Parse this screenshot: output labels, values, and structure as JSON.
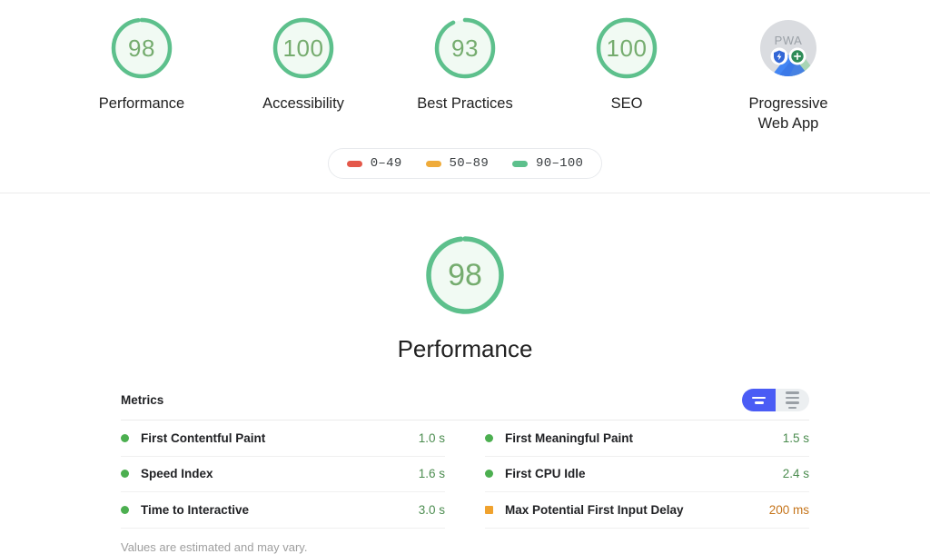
{
  "colors": {
    "pass": "#5dc08c",
    "pass_text": "#75ac6e",
    "pass_fill": "#f1faf3",
    "average": "#efab3a",
    "fail": "#e4584a",
    "metric_pass": "#4caf50",
    "metric_pass_text": "#4b8c4f",
    "metric_average": "#f0a22e",
    "metric_average_text": "#c5741a",
    "toggle_active": "#4a5cf5",
    "toggle_inactive": "#eceff1"
  },
  "summary": {
    "gauges": [
      {
        "label": "Performance",
        "score": "98",
        "value": 98,
        "status": "pass"
      },
      {
        "label": "Accessibility",
        "score": "100",
        "value": 100,
        "status": "pass"
      },
      {
        "label": "Best Practices",
        "score": "93",
        "value": 93,
        "status": "pass"
      },
      {
        "label": "SEO",
        "score": "100",
        "value": 100,
        "status": "pass"
      }
    ],
    "pwa": {
      "label": "Progressive Web App",
      "label_line1": "Progressive",
      "label_line2": "Web App",
      "badge_text": "PWA"
    },
    "legend": [
      {
        "range": "0–49",
        "color": "#e4584a"
      },
      {
        "range": "50–89",
        "color": "#efab3a"
      },
      {
        "range": "90–100",
        "color": "#5dc08c"
      }
    ]
  },
  "category": {
    "title": "Performance",
    "score": "98",
    "value": 98,
    "status": "pass"
  },
  "metrics": {
    "heading": "Metrics",
    "toggle": {
      "visual_label": "visual-view",
      "list_label": "list-view",
      "active": "visual-view"
    },
    "left": [
      {
        "name": "First Contentful Paint",
        "value": "1.0 s",
        "status": "pass",
        "marker": "circle"
      },
      {
        "name": "Speed Index",
        "value": "1.6 s",
        "status": "pass",
        "marker": "circle"
      },
      {
        "name": "Time to Interactive",
        "value": "3.0 s",
        "status": "pass",
        "marker": "circle"
      }
    ],
    "right": [
      {
        "name": "First Meaningful Paint",
        "value": "1.5 s",
        "status": "pass",
        "marker": "circle"
      },
      {
        "name": "First CPU Idle",
        "value": "2.4 s",
        "status": "pass",
        "marker": "circle"
      },
      {
        "name": "Max Potential First Input Delay",
        "value": "200 ms",
        "status": "average",
        "marker": "square"
      }
    ],
    "footer": "Values are estimated and may vary."
  }
}
